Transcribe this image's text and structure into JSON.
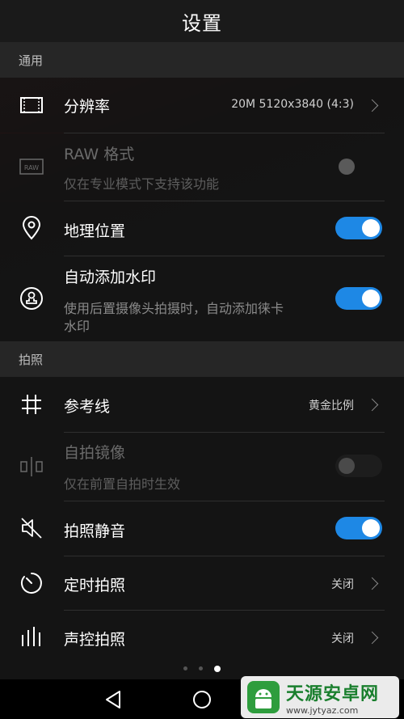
{
  "header": {
    "title": "设置"
  },
  "sections": {
    "general": "通用",
    "photo": "拍照"
  },
  "rows": {
    "resolution": {
      "label": "分辨率",
      "value": "20M 5120x3840 (4:3)",
      "icon": "resolution-icon"
    },
    "raw": {
      "label": "RAW 格式",
      "sub": "仅在专业模式下支持该功能",
      "icon": "raw-icon",
      "enabled": false,
      "toggle": "off"
    },
    "location": {
      "label": "地理位置",
      "icon": "location-pin-icon",
      "toggle": "on"
    },
    "watermark": {
      "label": "自动添加水印",
      "sub_line1": "使用后置摄像头拍摄时，自动添加徕卡",
      "sub_line2": "水印",
      "icon": "watermark-stamp-icon",
      "toggle": "on"
    },
    "grid": {
      "label": "参考线",
      "value": "黄金比例",
      "icon": "grid-icon"
    },
    "mirror": {
      "label": "自拍镜像",
      "sub": "仅在前置自拍时生效",
      "icon": "mirror-icon",
      "enabled": false,
      "toggle": "off"
    },
    "mute": {
      "label": "拍照静音",
      "icon": "speaker-mute-icon",
      "toggle": "on"
    },
    "timer": {
      "label": "定时拍照",
      "value": "关闭",
      "icon": "timer-icon"
    },
    "voice": {
      "label": "声控拍照",
      "value": "关闭",
      "icon": "voice-bars-icon"
    }
  },
  "pager": {
    "count": 3,
    "active": 3
  },
  "nav": {
    "back": "back-triangle-icon",
    "home": "home-circle-icon"
  },
  "watermark_overlay": {
    "title": "天源安卓网",
    "url": "www.jytyaz.com"
  },
  "colors": {
    "accent": "#1e88e5",
    "background": "#141414",
    "section": "#262626"
  }
}
